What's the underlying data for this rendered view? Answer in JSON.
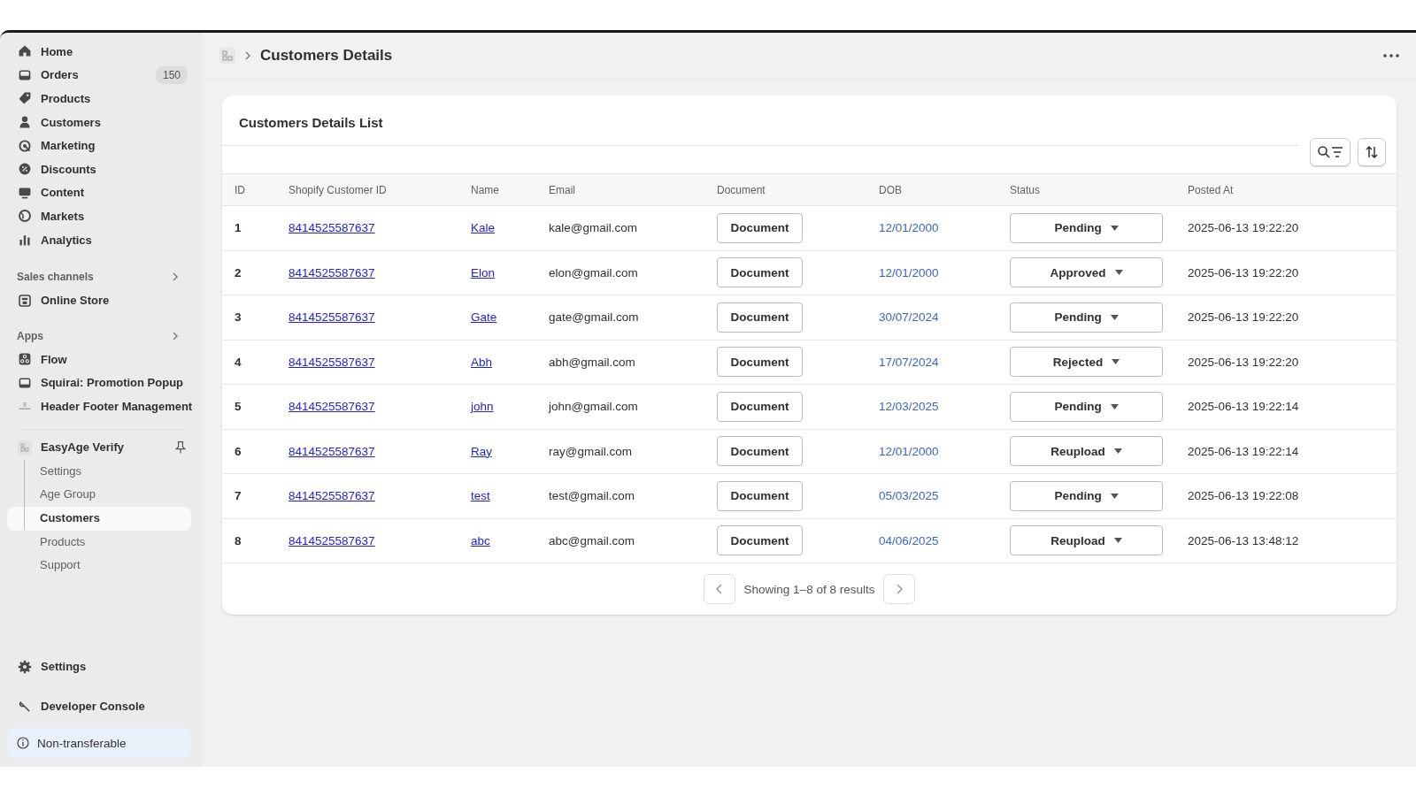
{
  "sidebar": {
    "main_items": [
      {
        "label": "Home"
      },
      {
        "label": "Orders",
        "badge": "150"
      },
      {
        "label": "Products"
      },
      {
        "label": "Customers"
      },
      {
        "label": "Marketing"
      },
      {
        "label": "Discounts"
      },
      {
        "label": "Content"
      },
      {
        "label": "Markets"
      },
      {
        "label": "Analytics"
      }
    ],
    "sales_channels": {
      "heading": "Sales channels",
      "items": [
        {
          "label": "Online Store"
        }
      ]
    },
    "apps": {
      "heading": "Apps",
      "items": [
        {
          "label": "Flow"
        },
        {
          "label": "Squirai: Promotion Popup"
        },
        {
          "label": "Header Footer Management"
        }
      ]
    },
    "app": {
      "name": "EasyAge Verify",
      "children": [
        {
          "label": "Settings",
          "selected": false
        },
        {
          "label": "Age Group",
          "selected": false
        },
        {
          "label": "Customers",
          "selected": true
        },
        {
          "label": "Products",
          "selected": false
        },
        {
          "label": "Support",
          "selected": false
        }
      ]
    },
    "bottom_items": [
      {
        "label": "Settings"
      },
      {
        "label": "Developer Console"
      }
    ],
    "notice": "Non-transferable"
  },
  "header": {
    "title": "Customers Details"
  },
  "card": {
    "title": "Customers Details List",
    "table": {
      "columns": [
        "ID",
        "Shopify Customer ID",
        "Name",
        "Email",
        "Document",
        "DOB",
        "Status",
        "Posted At"
      ],
      "rows": [
        {
          "id": "1",
          "shopify_customer_id": "8414525587637",
          "name": "Kale",
          "email": "kale@gmail.com",
          "document": "Document",
          "dob": "12/01/2000",
          "status": "Pending",
          "posted_at": "2025-06-13 19:22:20"
        },
        {
          "id": "2",
          "shopify_customer_id": "8414525587637",
          "name": "Elon",
          "email": "elon@gmail.com",
          "document": "Document",
          "dob": "12/01/2000",
          "status": "Approved",
          "posted_at": "2025-06-13 19:22:20"
        },
        {
          "id": "3",
          "shopify_customer_id": "8414525587637",
          "name": "Gate",
          "email": "gate@gmail.com",
          "document": "Document",
          "dob": "30/07/2024",
          "status": "Pending",
          "posted_at": "2025-06-13 19:22:20"
        },
        {
          "id": "4",
          "shopify_customer_id": "8414525587637",
          "name": "Abh",
          "email": "abh@gmail.com",
          "document": "Document",
          "dob": "17/07/2024",
          "status": "Rejected",
          "posted_at": "2025-06-13 19:22:20"
        },
        {
          "id": "5",
          "shopify_customer_id": "8414525587637",
          "name": "john",
          "email": "john@gmail.com",
          "document": "Document",
          "dob": "12/03/2025",
          "status": "Pending",
          "posted_at": "2025-06-13 19:22:14"
        },
        {
          "id": "6",
          "shopify_customer_id": "8414525587637",
          "name": "Ray",
          "email": "ray@gmail.com",
          "document": "Document",
          "dob": "12/01/2000",
          "status": "Reupload",
          "posted_at": "2025-06-13 19:22:14"
        },
        {
          "id": "7",
          "shopify_customer_id": "8414525587637",
          "name": "test",
          "email": "test@gmail.com",
          "document": "Document",
          "dob": "05/03/2025",
          "status": "Pending",
          "posted_at": "2025-06-13 19:22:08"
        },
        {
          "id": "8",
          "shopify_customer_id": "8414525587637",
          "name": "abc",
          "email": "abc@gmail.com",
          "document": "Document",
          "dob": "04/06/2025",
          "status": "Reupload",
          "posted_at": "2025-06-13 13:48:12"
        }
      ]
    },
    "pagination": "Showing 1–8 of 8 results"
  }
}
